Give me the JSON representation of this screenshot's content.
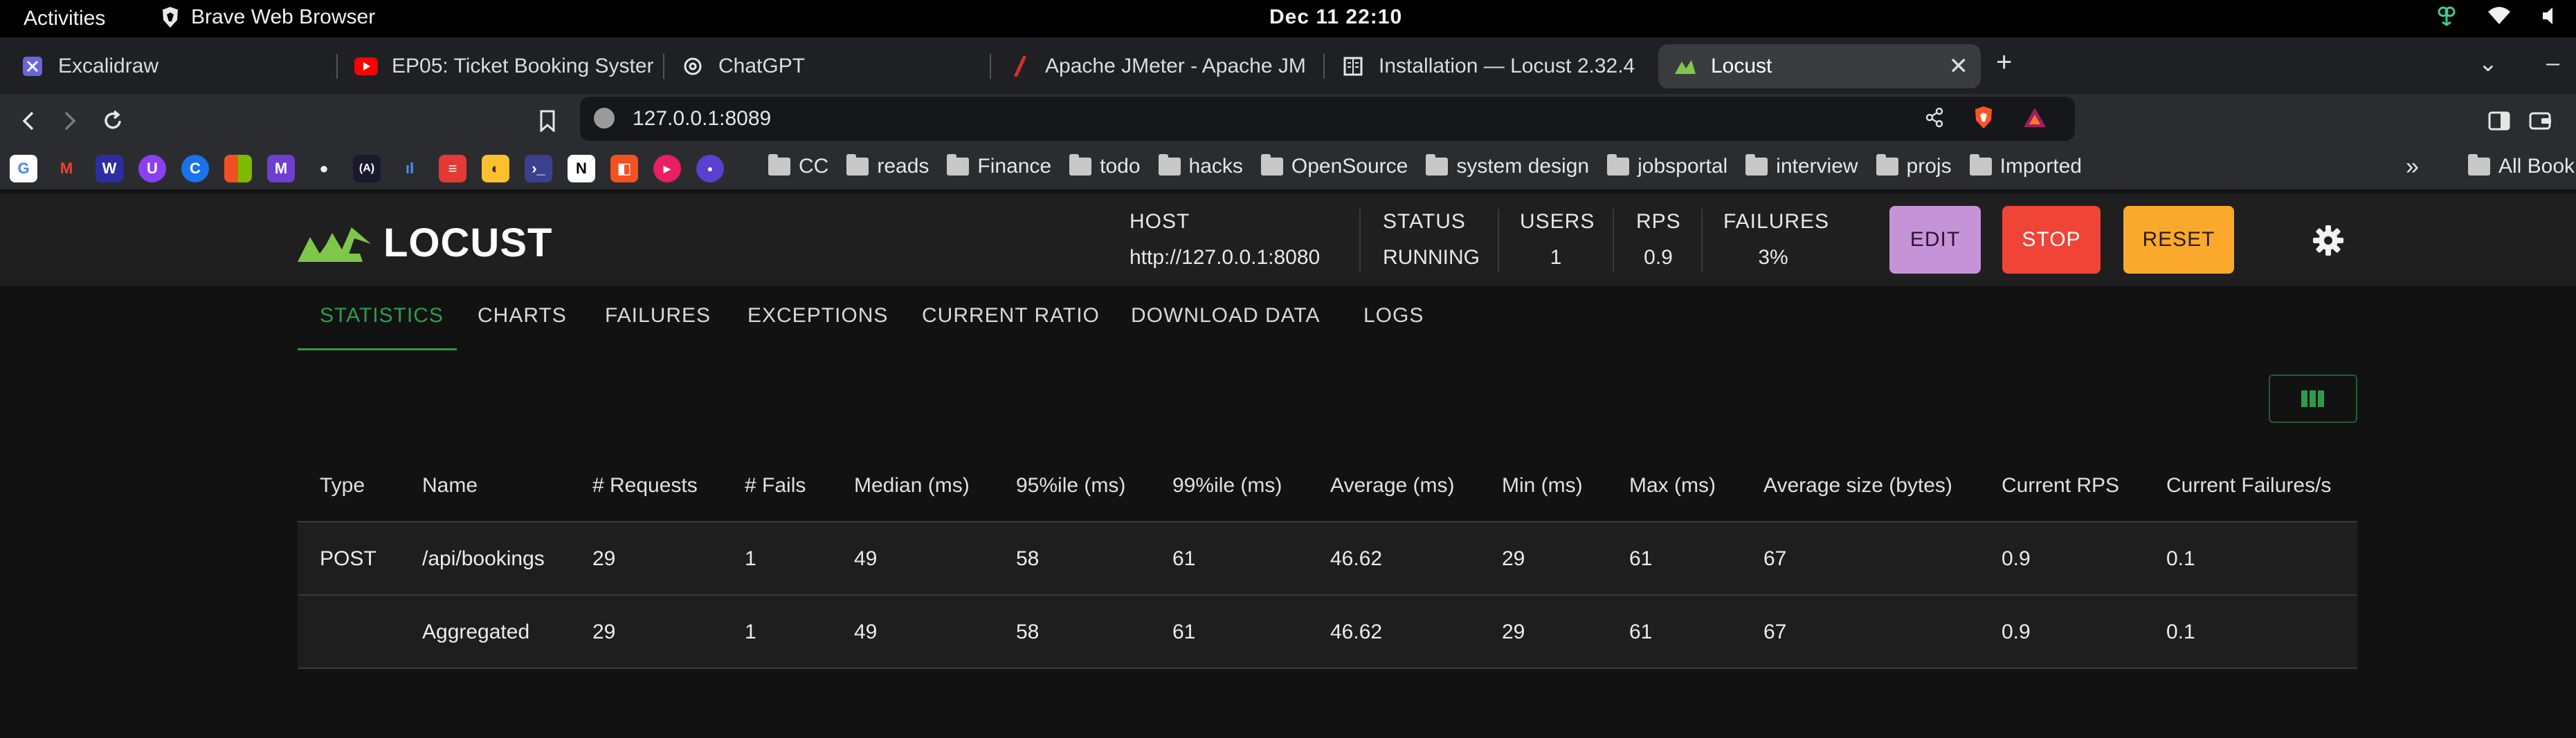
{
  "os": {
    "activities": "Activities",
    "app_name": "Brave Web Browser",
    "clock": "Dec 11  22:10"
  },
  "tabs": [
    {
      "title": "Excalidraw",
      "icon": "excalidraw-icon"
    },
    {
      "title": "EP05: Ticket Booking Syster",
      "icon": "youtube-icon"
    },
    {
      "title": "ChatGPT",
      "icon": "chatgpt-icon"
    },
    {
      "title": "Apache JMeter - Apache JM",
      "icon": "jmeter-icon"
    },
    {
      "title": "Installation — Locust 2.32.4",
      "icon": "docs-icon"
    },
    {
      "title": "Locust",
      "icon": "locust-icon",
      "active": true
    }
  ],
  "browser": {
    "url": "127.0.0.1:8089",
    "new_tab": "+",
    "more_bookmarks": "»",
    "all_bookmarks": "All Bookmarks"
  },
  "bookmarks": [
    "CC",
    "reads",
    "Finance",
    "todo",
    "hacks",
    "OpenSource",
    "system design",
    "jobsportal",
    "interview",
    "projs",
    "Imported"
  ],
  "locust": {
    "logo_text": "LOCUST",
    "host_label": "HOST",
    "host_value": "http://127.0.0.1:8080",
    "status_label": "STATUS",
    "status_value": "RUNNING",
    "users_label": "USERS",
    "users_value": "1",
    "rps_label": "RPS",
    "rps_value": "0.9",
    "failures_label": "FAILURES",
    "failures_value": "3%",
    "edit_label": "EDIT",
    "stop_label": "STOP",
    "reset_label": "RESET",
    "nav": [
      "STATISTICS",
      "CHARTS",
      "FAILURES",
      "EXCEPTIONS",
      "CURRENT RATIO",
      "DOWNLOAD DATA",
      "LOGS"
    ],
    "accent": "#2d9c4a"
  },
  "table": {
    "headers": [
      "Type",
      "Name",
      "# Requests",
      "# Fails",
      "Median (ms)",
      "95%ile (ms)",
      "99%ile (ms)",
      "Average (ms)",
      "Min (ms)",
      "Max (ms)",
      "Average size (bytes)",
      "Current RPS",
      "Current Failures/s"
    ],
    "rows": [
      [
        "POST",
        "/api/bookings",
        "29",
        "1",
        "49",
        "58",
        "61",
        "46.62",
        "29",
        "61",
        "67",
        "0.9",
        "0.1"
      ],
      [
        "",
        "Aggregated",
        "29",
        "1",
        "49",
        "58",
        "61",
        "46.62",
        "29",
        "61",
        "67",
        "0.9",
        "0.1"
      ]
    ]
  }
}
